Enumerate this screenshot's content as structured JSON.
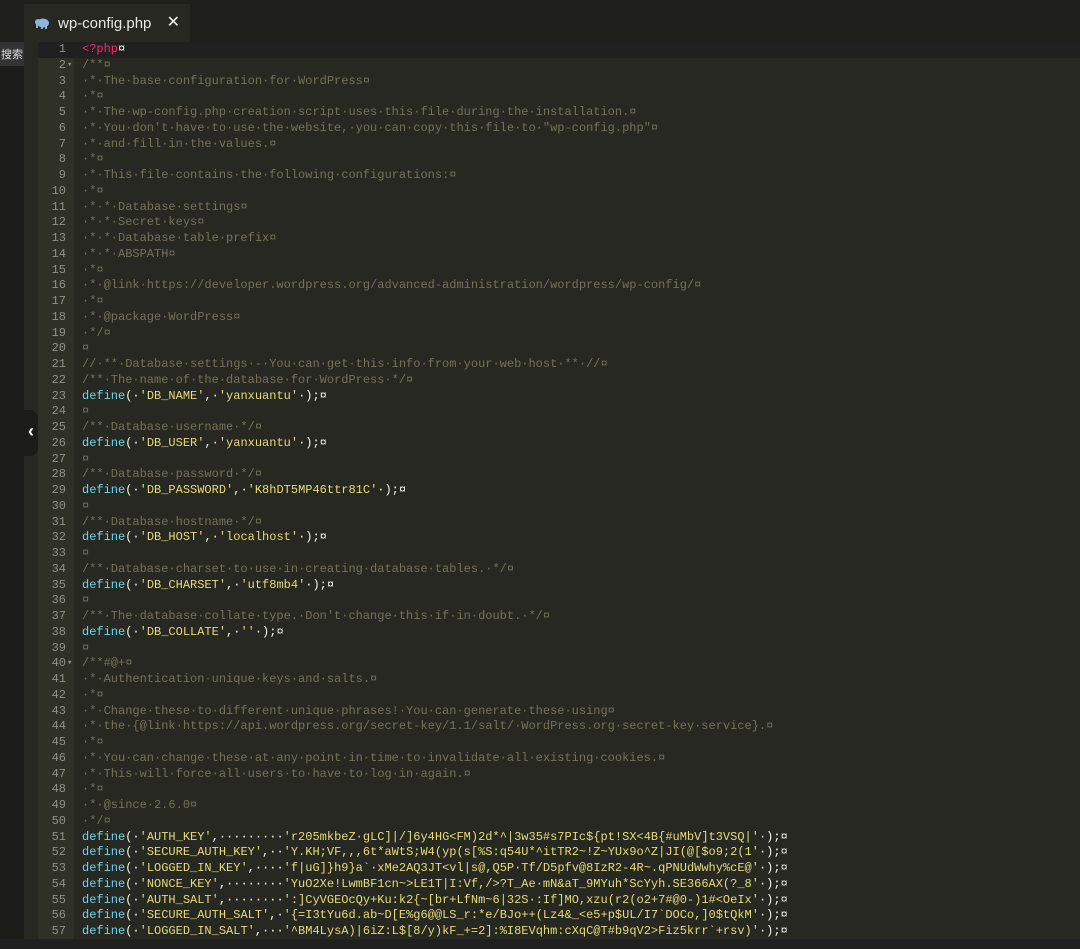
{
  "tab": {
    "filename": "wp-config.php",
    "close_label": "✕"
  },
  "sidebar": {
    "label": "搜索",
    "collapse_label": "‹"
  },
  "colors": {
    "background": "#272822",
    "comment": "#75715e",
    "keyword": "#66d9ef",
    "string": "#e6db74"
  },
  "lines": [
    {
      "n": "1",
      "t": "<?php¤"
    },
    {
      "n": "2",
      "t": "/**¤"
    },
    {
      "n": "3",
      "t": "·*·The·base·configuration·for·WordPress¤"
    },
    {
      "n": "4",
      "t": "·*¤"
    },
    {
      "n": "5",
      "t": "·*·The·wp-config.php·creation·script·uses·this·file·during·the·installation.¤"
    },
    {
      "n": "6",
      "t": "·*·You·don't·have·to·use·the·website,·you·can·copy·this·file·to·\"wp-config.php\"¤"
    },
    {
      "n": "7",
      "t": "·*·and·fill·in·the·values.¤"
    },
    {
      "n": "8",
      "t": "·*¤"
    },
    {
      "n": "9",
      "t": "·*·This·file·contains·the·following·configurations:¤"
    },
    {
      "n": "10",
      "t": "·*¤"
    },
    {
      "n": "11",
      "t": "·*·*·Database·settings¤"
    },
    {
      "n": "12",
      "t": "·*·*·Secret·keys¤"
    },
    {
      "n": "13",
      "t": "·*·*·Database·table·prefix¤"
    },
    {
      "n": "14",
      "t": "·*·*·ABSPATH¤"
    },
    {
      "n": "15",
      "t": "·*¤"
    },
    {
      "n": "16",
      "t": "·*·@link·https://developer.wordpress.org/advanced-administration/wordpress/wp-config/¤"
    },
    {
      "n": "17",
      "t": "·*¤"
    },
    {
      "n": "18",
      "t": "·*·@package·WordPress¤"
    },
    {
      "n": "19",
      "t": "·*/¤"
    },
    {
      "n": "20",
      "t": "¤"
    },
    {
      "n": "21",
      "t": "//·**·Database·settings·-·You·can·get·this·info·from·your·web·host·**·//¤"
    },
    {
      "n": "22",
      "t": "/**·The·name·of·the·database·for·WordPress·*/¤"
    },
    {
      "n": "23",
      "t": "define(·'DB_NAME',·'yanxuantu'·);¤"
    },
    {
      "n": "24",
      "t": "¤"
    },
    {
      "n": "25",
      "t": "/**·Database·username·*/¤"
    },
    {
      "n": "26",
      "t": "define(·'DB_USER',·'yanxuantu'·);¤"
    },
    {
      "n": "27",
      "t": "¤"
    },
    {
      "n": "28",
      "t": "/**·Database·password·*/¤"
    },
    {
      "n": "29",
      "t": "define(·'DB_PASSWORD',·'K8hDT5MP46ttr81C'·);¤"
    },
    {
      "n": "30",
      "t": "¤"
    },
    {
      "n": "31",
      "t": "/**·Database·hostname·*/¤"
    },
    {
      "n": "32",
      "t": "define(·'DB_HOST',·'localhost'·);¤"
    },
    {
      "n": "33",
      "t": "¤"
    },
    {
      "n": "34",
      "t": "/**·Database·charset·to·use·in·creating·database·tables.·*/¤"
    },
    {
      "n": "35",
      "t": "define(·'DB_CHARSET',·'utf8mb4'·);¤"
    },
    {
      "n": "36",
      "t": "¤"
    },
    {
      "n": "37",
      "t": "/**·The·database·collate·type.·Don't·change·this·if·in·doubt.·*/¤"
    },
    {
      "n": "38",
      "t": "define(·'DB_COLLATE',·''·);¤"
    },
    {
      "n": "39",
      "t": "¤"
    },
    {
      "n": "40",
      "t": "/**#@+¤"
    },
    {
      "n": "41",
      "t": "·*·Authentication·unique·keys·and·salts.¤"
    },
    {
      "n": "42",
      "t": "·*¤"
    },
    {
      "n": "43",
      "t": "·*·Change·these·to·different·unique·phrases!·You·can·generate·these·using¤"
    },
    {
      "n": "44",
      "t": "·*·the·{@link·https://api.wordpress.org/secret-key/1.1/salt/·WordPress.org·secret-key·service}.¤"
    },
    {
      "n": "45",
      "t": "·*¤"
    },
    {
      "n": "46",
      "t": "·*·You·can·change·these·at·any·point·in·time·to·invalidate·all·existing·cookies.¤"
    },
    {
      "n": "47",
      "t": "·*·This·will·force·all·users·to·have·to·log·in·again.¤"
    },
    {
      "n": "48",
      "t": "·*¤"
    },
    {
      "n": "49",
      "t": "·*·@since·2.6.0¤"
    },
    {
      "n": "50",
      "t": "·*/¤"
    },
    {
      "n": "51",
      "t": "define(·'AUTH_KEY',·········'r205mkbeZ·gLC]|/]6y4HG<FM)2d*^|3w35#s7PIc${pt!SX<4B{#uMbV]t3VSQ|'·);¤"
    },
    {
      "n": "52",
      "t": "define(·'SECURE_AUTH_KEY',··'Y.KH;VF,,,6t*aWtS;W4(yp(s[%S:q54U*^itTR2~!Z~YUx9o^Z|JI(@[$o9;2(1'·);¤"
    },
    {
      "n": "53",
      "t": "define(·'LOGGED_IN_KEY',····'f|uG]}h9}a`·xMe2AQ3JT<vl|s@,Q5P·Tf/D5pfv@8IzR2-4R~.qPNUdWwhy%cE@'·);¤"
    },
    {
      "n": "54",
      "t": "define(·'NONCE_KEY',········'YuO2Xe!LwmBF1cn~>LE1T|I:Vf,/>?T_Ae·mN&aT_9MYuh*ScYyh.SE366AX(?_8'·);¤"
    },
    {
      "n": "55",
      "t": "define(·'AUTH_SALT',········':]CyVGEOcQy+Ku:k2{~[br+LfNm~6|32S·:If]MO,xzu(r2(o2+7#@0-)1#<OeIx'·);¤"
    },
    {
      "n": "56",
      "t": "define(·'SECURE_AUTH_SALT',·'{=I3tYu6d.ab~D[E%g6@@LS_r:*e/BJo++(Lz4&_<e5+p$UL/I7`DOCo,]0$tQkM'·);¤"
    },
    {
      "n": "57",
      "t": "define(·'LOGGED_IN_SALT',···'^BM4LysA)|6iZ:L$[8/y)kF_+=2]:%I8EVqhm:cXqC@T#b9qV2>Fiz5krr`+rsv)'·);¤"
    }
  ]
}
